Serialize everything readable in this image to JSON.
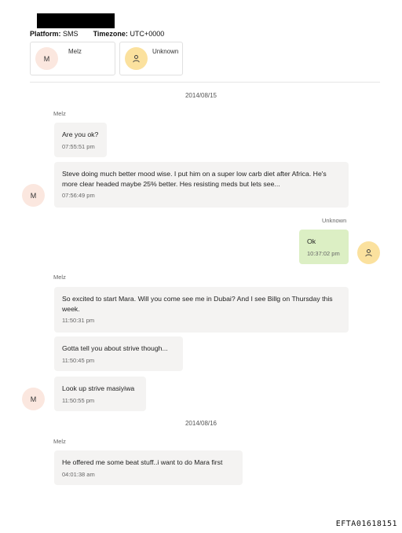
{
  "header": {
    "platform_label": "Platform:",
    "platform_value": "SMS",
    "timezone_label": "Timezone:",
    "timezone_value": "UTC+0000"
  },
  "participants": [
    {
      "initial": "M",
      "name": "Melz",
      "avatar_color": "#fbe7df"
    },
    {
      "icon": "person-icon",
      "name": "Unknown",
      "avatar_color": "#fbe19e"
    }
  ],
  "conversation": {
    "date1": "2014/08/15",
    "sender1": "Melz",
    "msg1": {
      "text": "Are you ok?",
      "time": "07:55:51 pm"
    },
    "msg2": {
      "text": "Steve doing much better mood wise. I put him on a super low carb diet after Africa. He's more clear headed maybe 25% better. Hes resisting meds but lets see...",
      "time": "07:56:49 pm"
    },
    "avatar_m": "M",
    "sender_unknown": "Unknown",
    "msg3": {
      "text": "Ok",
      "time": "10:37:02 pm"
    },
    "sender2": "Melz",
    "msg4": {
      "text": "So excited to start Mara. Will you come see me in Dubai? And I see Billg on Thursday this week.",
      "time": "11:50:31 pm"
    },
    "msg5": {
      "text": "Gotta tell you about strive though...",
      "time": "11:50:45 pm"
    },
    "msg6": {
      "text": "Look up strive masiyiwa",
      "time": "11:50:55 pm"
    },
    "date2": "2014/08/16",
    "sender3": "Melz",
    "msg7": {
      "text": "He offered me some beat stuff..i want to do Mara first",
      "time": "04:01:38 am"
    }
  },
  "colors": {
    "incoming_bubble": "#f4f3f2",
    "outgoing_bubble": "#dcefc4",
    "avatar_m": "#fbe7df",
    "avatar_unknown": "#fbe19e"
  },
  "footer": {
    "doc_id": "EFTA01618151"
  }
}
